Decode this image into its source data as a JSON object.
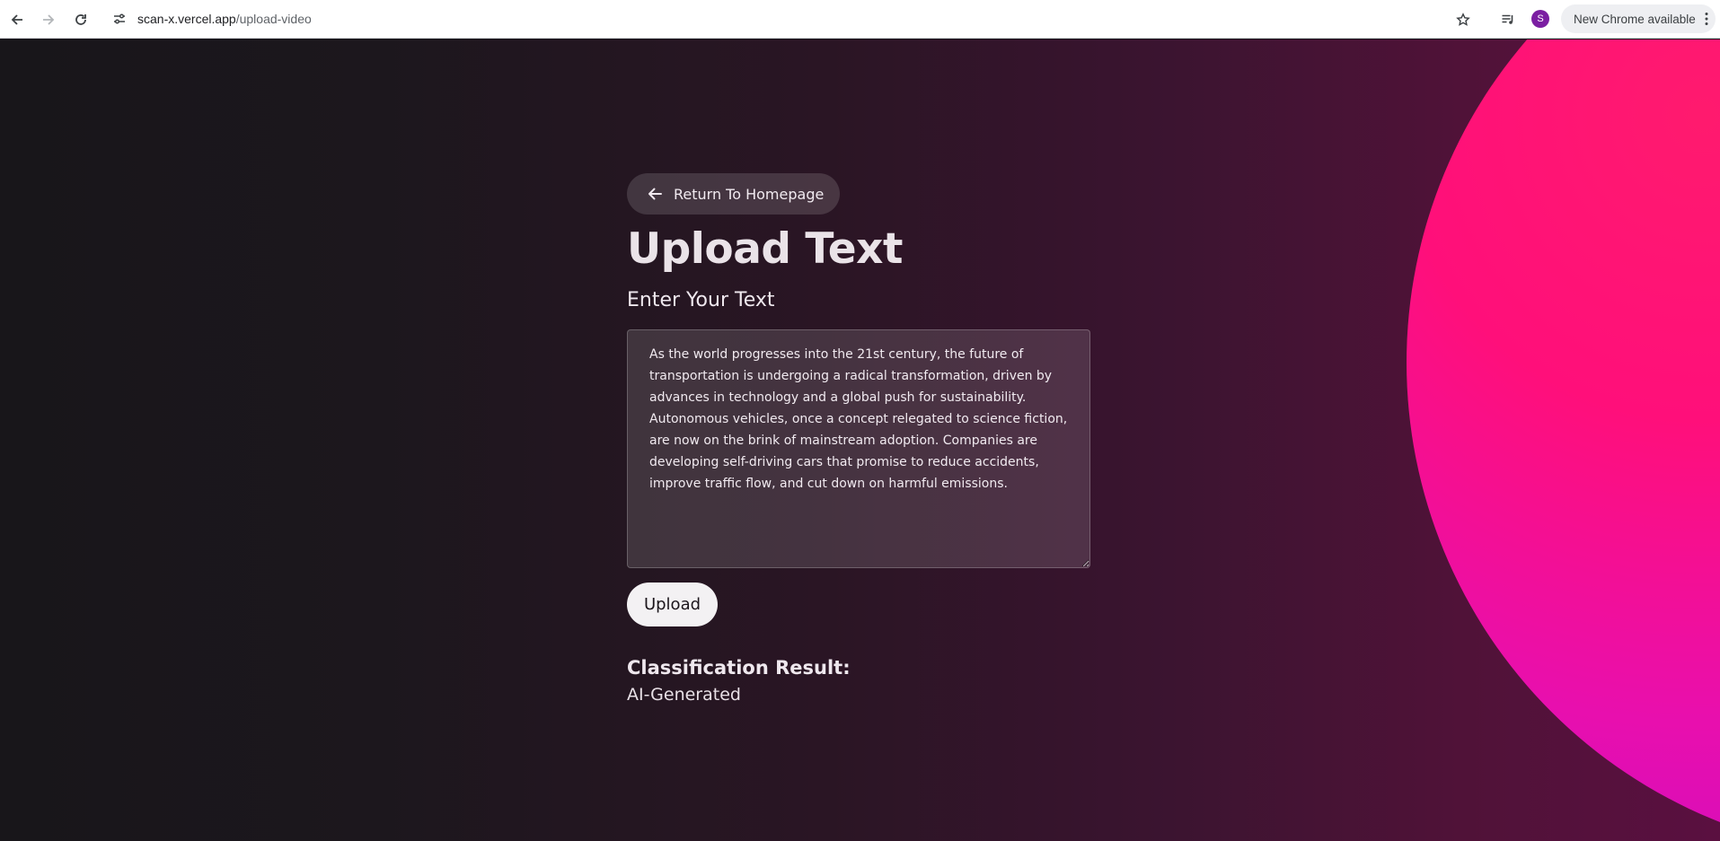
{
  "browser": {
    "url_host": "scan-x.vercel.app",
    "url_path": "/upload-video",
    "profile_initial": "S",
    "update_label": "New Chrome available"
  },
  "main": {
    "back_label": "Return To Homepage",
    "title": "Upload Text",
    "subtitle": "Enter Your Text",
    "textarea_value": "As the world progresses into the 21st century, the future of transportation is undergoing a radical transformation, driven by advances in technology and a global push for sustainability. Autonomous vehicles, once a concept relegated to science fiction, are now on the brink of mainstream adoption. Companies are developing self-driving cars that promise to reduce accidents, improve traffic flow, and cut down on harmful emissions.",
    "upload_label": "Upload",
    "result_heading": "Classification Result:",
    "result_value": "AI-Generated"
  },
  "colors": {
    "background_dark": "#18161a",
    "accent_pink": "#ff0f7a",
    "accent_purple": "#b80ad0"
  }
}
